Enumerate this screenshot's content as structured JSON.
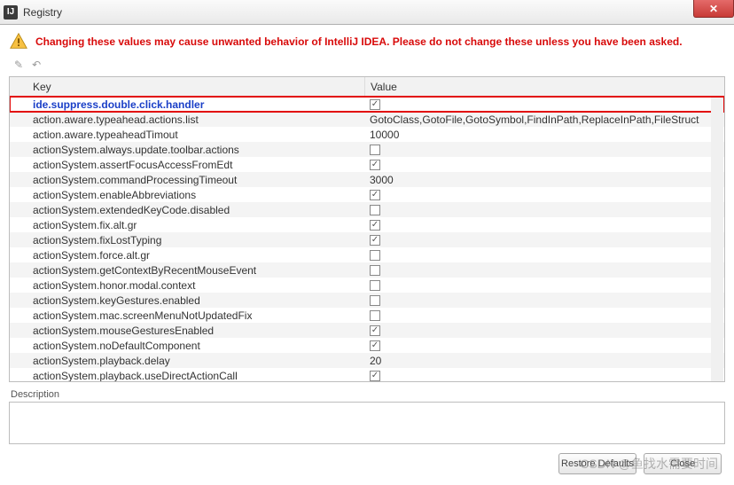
{
  "window": {
    "title": "Registry"
  },
  "warning": {
    "text": "Changing these values may cause unwanted behavior of IntelliJ IDEA. Please do not change these unless you have been asked."
  },
  "table": {
    "headers": {
      "key": "Key",
      "value": "Value"
    },
    "rows": [
      {
        "key": "ide.suppress.double.click.handler",
        "type": "checkbox",
        "checked": true,
        "highlight": true
      },
      {
        "key": "action.aware.typeahead.actions.list",
        "type": "text",
        "value": "GotoClass,GotoFile,GotoSymbol,FindInPath,ReplaceInPath,FileStruct"
      },
      {
        "key": "action.aware.typeaheadTimout",
        "type": "text",
        "value": "10000"
      },
      {
        "key": "actionSystem.always.update.toolbar.actions",
        "type": "checkbox",
        "checked": false
      },
      {
        "key": "actionSystem.assertFocusAccessFromEdt",
        "type": "checkbox",
        "checked": true
      },
      {
        "key": "actionSystem.commandProcessingTimeout",
        "type": "text",
        "value": "3000"
      },
      {
        "key": "actionSystem.enableAbbreviations",
        "type": "checkbox",
        "checked": true
      },
      {
        "key": "actionSystem.extendedKeyCode.disabled",
        "type": "checkbox",
        "checked": false
      },
      {
        "key": "actionSystem.fix.alt.gr",
        "type": "checkbox",
        "checked": true
      },
      {
        "key": "actionSystem.fixLostTyping",
        "type": "checkbox",
        "checked": true
      },
      {
        "key": "actionSystem.force.alt.gr",
        "type": "checkbox",
        "checked": false
      },
      {
        "key": "actionSystem.getContextByRecentMouseEvent",
        "type": "checkbox",
        "checked": false
      },
      {
        "key": "actionSystem.honor.modal.context",
        "type": "checkbox",
        "checked": false
      },
      {
        "key": "actionSystem.keyGestures.enabled",
        "type": "checkbox",
        "checked": false
      },
      {
        "key": "actionSystem.mac.screenMenuNotUpdatedFix",
        "type": "checkbox",
        "checked": false
      },
      {
        "key": "actionSystem.mouseGesturesEnabled",
        "type": "checkbox",
        "checked": true
      },
      {
        "key": "actionSystem.noDefaultComponent",
        "type": "checkbox",
        "checked": true
      },
      {
        "key": "actionSystem.playback.delay",
        "type": "text",
        "value": "20"
      },
      {
        "key": "actionSystem.playback.useDirectActionCall",
        "type": "checkbox",
        "checked": true
      }
    ]
  },
  "description": {
    "label": "Description"
  },
  "buttons": {
    "restore": "Restore Defaults",
    "close": "Close"
  },
  "watermark": "CSDN @鱼找水需要时间"
}
